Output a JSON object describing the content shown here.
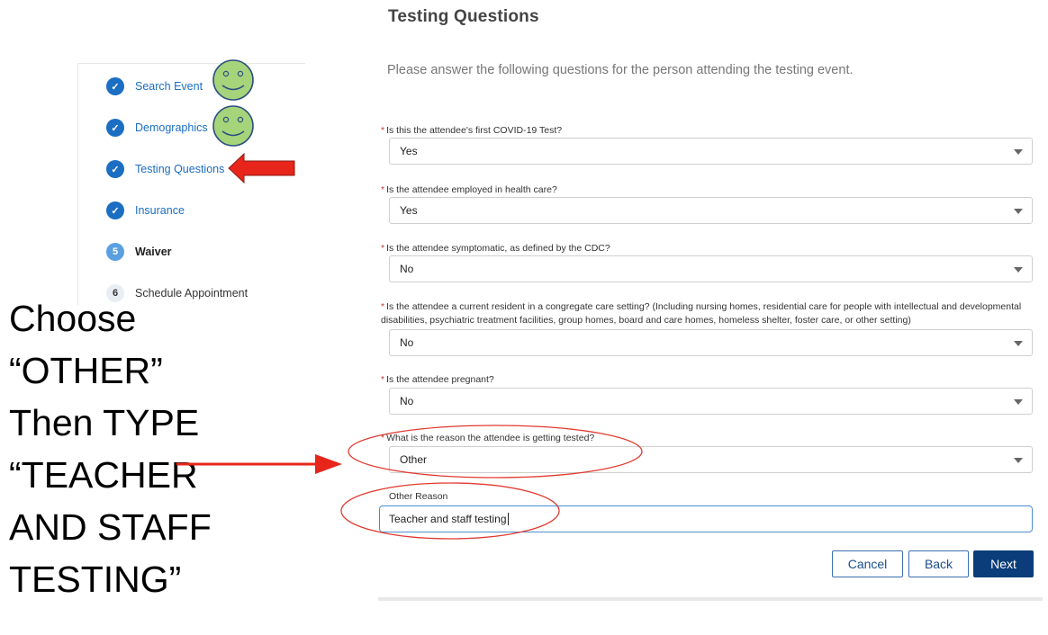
{
  "page": {
    "title": "Testing Questions",
    "intro": "Please answer the following questions for the person attending the testing event."
  },
  "steps": [
    {
      "marker": "✓",
      "label": "Search Event",
      "state": "done"
    },
    {
      "marker": "✓",
      "label": "Demographics",
      "state": "done"
    },
    {
      "marker": "✓",
      "label": "Testing Questions",
      "state": "done"
    },
    {
      "marker": "✓",
      "label": "Insurance",
      "state": "done"
    },
    {
      "marker": "5",
      "label": "Waiver",
      "state": "current"
    },
    {
      "marker": "6",
      "label": "Schedule Appointment",
      "state": "todo"
    }
  ],
  "required_mark": "*",
  "questions": [
    {
      "label": "Is this the attendee's first COVID-19 Test?",
      "value": "Yes"
    },
    {
      "label": "Is the attendee employed in health care?",
      "value": "Yes"
    },
    {
      "label": "Is the attendee symptomatic, as defined by the CDC?",
      "value": "No"
    },
    {
      "label": "Is the attendee a current resident in a congregate care setting? (Including nursing homes, residential care for people with intellectual and developmental disabilities, psychiatric treatment facilities, group homes, board and care homes, homeless shelter, foster care, or other setting)",
      "value": "No"
    },
    {
      "label": "Is the attendee pregnant?",
      "value": "No"
    },
    {
      "label": "What is the reason the attendee is getting tested?",
      "value": "Other"
    }
  ],
  "other_reason": {
    "label": "Other Reason",
    "value": "Teacher and staff testing"
  },
  "buttons": {
    "cancel": "Cancel",
    "back": "Back",
    "next": "Next"
  },
  "annotation": {
    "lines": [
      "Choose",
      "“OTHER”",
      "Then TYPE",
      "“TEACHER",
      "AND STAFF",
      "TESTING”"
    ],
    "colors": {
      "arrow": "#e8251b",
      "circle": "#e03a30",
      "smiley_fill": "#a6d47b",
      "smiley_stroke": "#2d4f80"
    }
  }
}
